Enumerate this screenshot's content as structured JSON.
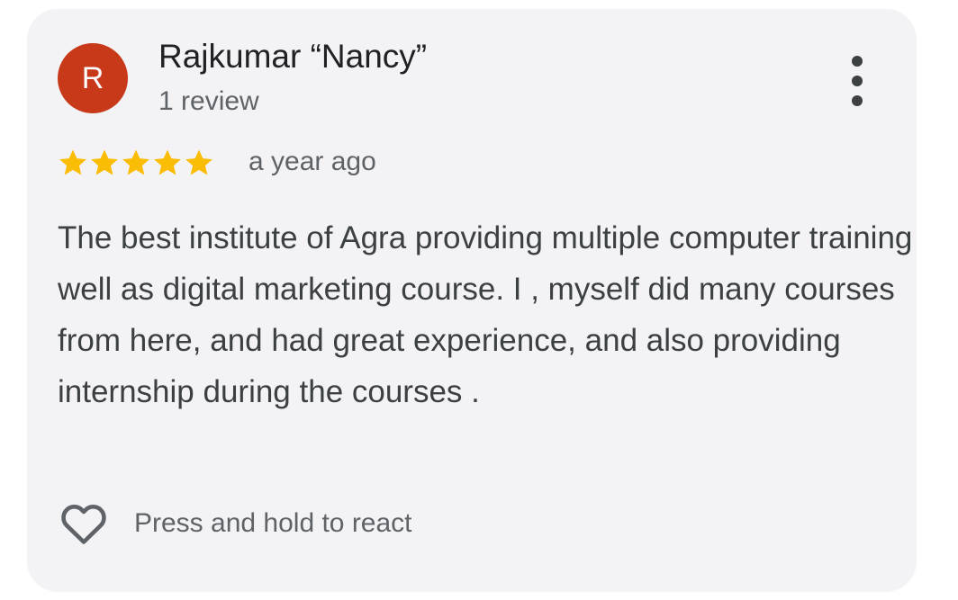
{
  "reviewer": {
    "initial": "R",
    "name": "Rajkumar “Nancy”",
    "review_count": "1 review",
    "avatar_color": "#c8391a"
  },
  "rating": {
    "stars": 5,
    "max_stars": 5,
    "star_color": "#fbbc04",
    "time_ago": "a year ago"
  },
  "review": {
    "text": "The best institute of Agra providing multiple computer training well as digital marketing course. I , myself did many courses from here, and had great experience, and also providing internship during the courses ."
  },
  "actions": {
    "react_label": "Press and hold to react",
    "react_icon": "heart-outline-icon",
    "menu_icon": "more-vert-icon"
  }
}
